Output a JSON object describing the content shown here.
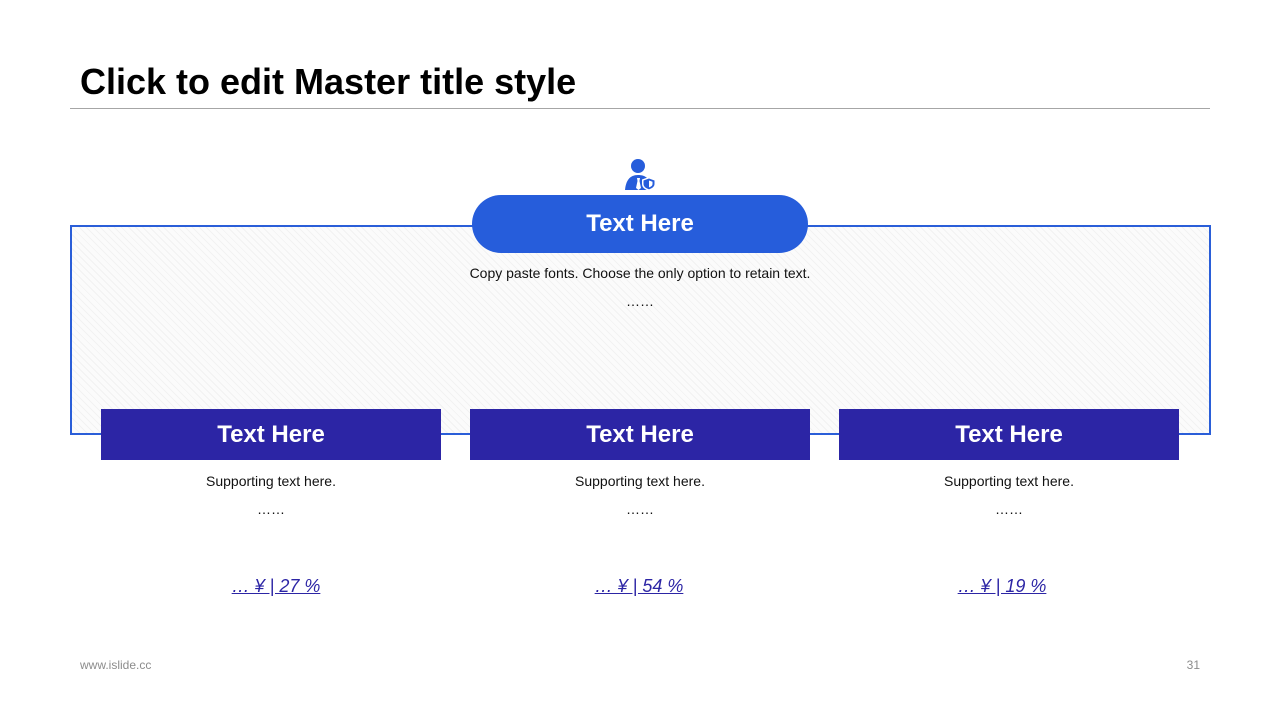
{
  "slide": {
    "title": "Click to edit Master title style",
    "accent_color": "#265ddb",
    "card_color": "#2c25a5"
  },
  "main": {
    "icon": "user-shield-icon",
    "heading": "Text Here",
    "text": "Copy paste fonts. Choose the only option to retain text.",
    "dots": "……"
  },
  "cards": [
    {
      "heading": "Text Here",
      "text": "Supporting text here.",
      "dots": "……",
      "stat": "…  ¥ | 27 %"
    },
    {
      "heading": "Text Here",
      "text": "Supporting text here.",
      "dots": "……",
      "stat": "…  ¥ | 54 %"
    },
    {
      "heading": "Text Here",
      "text": "Supporting text here.",
      "dots": "……",
      "stat": "…  ¥ | 19 %"
    }
  ],
  "footer": {
    "website": "www.islide.cc",
    "page_number": "31"
  }
}
